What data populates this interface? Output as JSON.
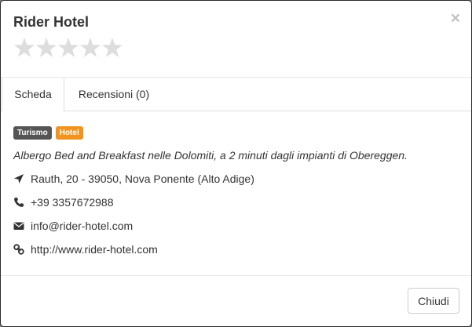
{
  "modal": {
    "title": "Rider Hotel",
    "close_symbol": "×",
    "rating": {
      "value": 0,
      "max": 5,
      "icon": "star-icon",
      "empty_color": "#dddddd"
    }
  },
  "tabs": [
    {
      "label": "Scheda",
      "active": true
    },
    {
      "label": "Recensioni (0)",
      "active": false
    }
  ],
  "details": {
    "badges": [
      {
        "label": "Turismo",
        "color": "#555555"
      },
      {
        "label": "Hotel",
        "color": "#f0931f"
      }
    ],
    "description": "Albergo Bed and Breakfast nelle Dolomiti, a 2 minuti dagli impianti di Obereggen.",
    "address": {
      "icon": "location-arrow-icon",
      "text": "Rauth, 20 - 39050, Nova Ponente (Alto Adige)"
    },
    "phone": {
      "icon": "phone-icon",
      "text": "+39 3357672988"
    },
    "email": {
      "icon": "envelope-icon",
      "text": "info@rider-hotel.com"
    },
    "website": {
      "icon": "link-icon",
      "text": "http://www.rider-hotel.com"
    }
  },
  "footer": {
    "close_label": "Chiudi"
  }
}
